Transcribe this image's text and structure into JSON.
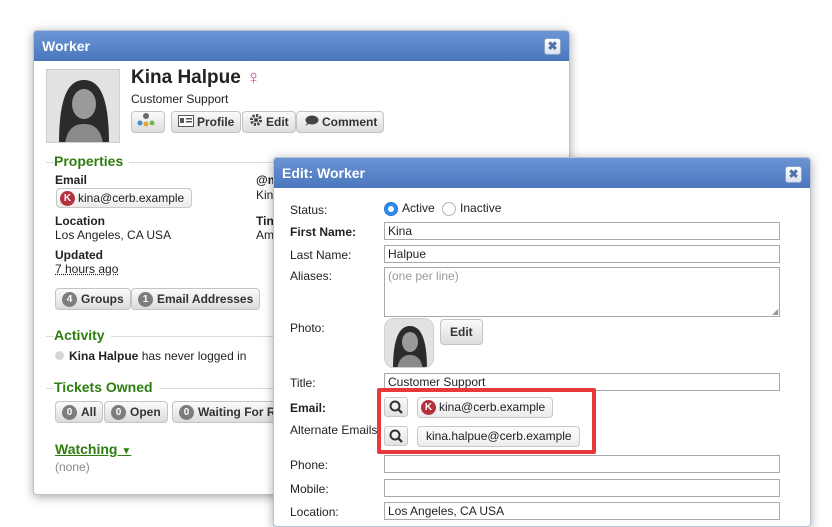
{
  "worker_card": {
    "title": "Worker",
    "name": "Kina Halpue",
    "job_title": "Customer Support",
    "buttons": {
      "profile": "Profile",
      "edit": "Edit",
      "comment": "Comment"
    },
    "properties": {
      "heading": "Properties",
      "email_label": "Email",
      "email_value": "kina@cerb.example",
      "mention_label": "@m",
      "mention_value": "Kin",
      "location_label": "Location",
      "location_value": "Los Angeles, CA USA",
      "timezone_label": "Tin",
      "timezone_value": "Am",
      "updated_label": "Updated",
      "updated_value": "7 hours ago",
      "groups_count": "4",
      "groups_label": "Groups",
      "email_addresses_count": "1",
      "email_addresses_label": "Email Addresses"
    },
    "activity": {
      "heading": "Activity",
      "name": "Kina Halpue",
      "text": "has never logged in"
    },
    "tickets": {
      "heading": "Tickets Owned",
      "all_count": "0",
      "all_label": "All",
      "open_count": "0",
      "open_label": "Open",
      "waiting_count": "0",
      "waiting_label": "Waiting For R"
    },
    "watching": {
      "heading": "Watching",
      "value": "(none)"
    }
  },
  "edit_dialog": {
    "title": "Edit: Worker",
    "status_label": "Status:",
    "status_active": "Active",
    "status_inactive": "Inactive",
    "first_name_label": "First Name:",
    "first_name_value": "Kina",
    "last_name_label": "Last Name:",
    "last_name_value": "Halpue",
    "aliases_label": "Aliases:",
    "aliases_placeholder": "(one per line)",
    "photo_label": "Photo:",
    "photo_edit": "Edit",
    "title_label": "Title:",
    "title_value": "Customer Support",
    "email_label": "Email:",
    "email_value": "kina@cerb.example",
    "alt_emails_label": "Alternate Emails:",
    "alt_email_value": "kina.halpue@cerb.example",
    "phone_label": "Phone:",
    "phone_value": "",
    "mobile_label": "Mobile:",
    "mobile_value": "",
    "location_label": "Location:",
    "location_value": "Los Angeles, CA USA"
  },
  "colors": {
    "title_bar": "#4a76bd",
    "section_heading": "#2e7d0f",
    "highlight_box": "#e8393a",
    "gender_icon": "#e0409a",
    "contact_badge": "#b3303f"
  }
}
